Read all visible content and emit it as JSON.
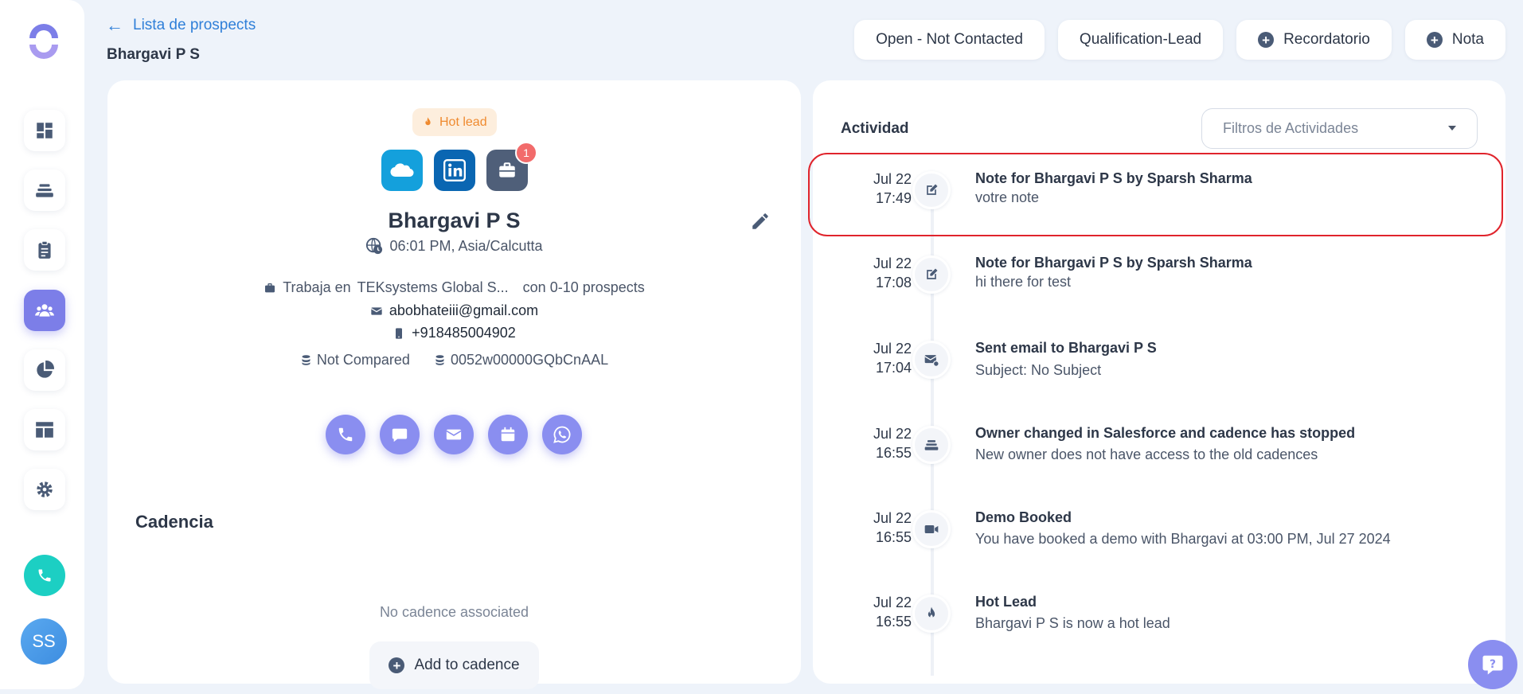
{
  "sidebar": {
    "avatar_initials": "SS",
    "accent": "#7c7ee8"
  },
  "header": {
    "back_label": "Lista de prospects",
    "prospect_name": "Bhargavi P S",
    "actions": [
      {
        "label": "Open - Not Contacted"
      },
      {
        "label": "Qualification-Lead"
      },
      {
        "label": "Recordatorio"
      },
      {
        "label": "Nota"
      }
    ]
  },
  "profile": {
    "hot_label": "Hot lead",
    "badge_count": "1",
    "name": "Bhargavi P S",
    "timezone": "06:01 PM, Asia/Calcutta",
    "works_prefix": "Trabaja en",
    "company": "TEKsystems Global S...",
    "company_size": "con 0-10 prospects",
    "email": "abobhateiii@gmail.com",
    "phone": "+918485004902",
    "compare_status": "Not Compared",
    "salesforce_id": "0052w00000GQbCnAAL"
  },
  "cadence": {
    "title": "Cadencia",
    "empty_text": "No cadence associated",
    "add_label": "Add to cadence"
  },
  "activity": {
    "title": "Actividad",
    "filter_placeholder": "Filtros de Actividades",
    "items": [
      {
        "date": "Jul 22",
        "time": "17:49",
        "icon": "edit-note-icon",
        "title": "Note for Bhargavi P S by Sparsh Sharma",
        "subtitle": "votre note"
      },
      {
        "date": "Jul 22",
        "time": "17:08",
        "icon": "edit-note-icon",
        "title": "Note for Bhargavi P S by Sparsh Sharma",
        "subtitle": "hi there for test"
      },
      {
        "date": "Jul 22",
        "time": "17:04",
        "icon": "email-sent-icon",
        "title": "Sent email to Bhargavi P S",
        "subtitle": "Subject: No Subject"
      },
      {
        "date": "Jul 22",
        "time": "16:55",
        "icon": "stack-icon",
        "title": "Owner changed in Salesforce and cadence has stopped",
        "subtitle": "New owner does not have access to the old cadences"
      },
      {
        "date": "Jul 22",
        "time": "16:55",
        "icon": "video-icon",
        "title": "Demo Booked",
        "subtitle": "You have booked a demo with Bhargavi at 03:00 PM, Jul 27 2024"
      },
      {
        "date": "Jul 22",
        "time": "16:55",
        "icon": "flame-icon",
        "title": "Hot Lead",
        "subtitle": "Bhargavi P S is now a hot lead"
      }
    ]
  }
}
